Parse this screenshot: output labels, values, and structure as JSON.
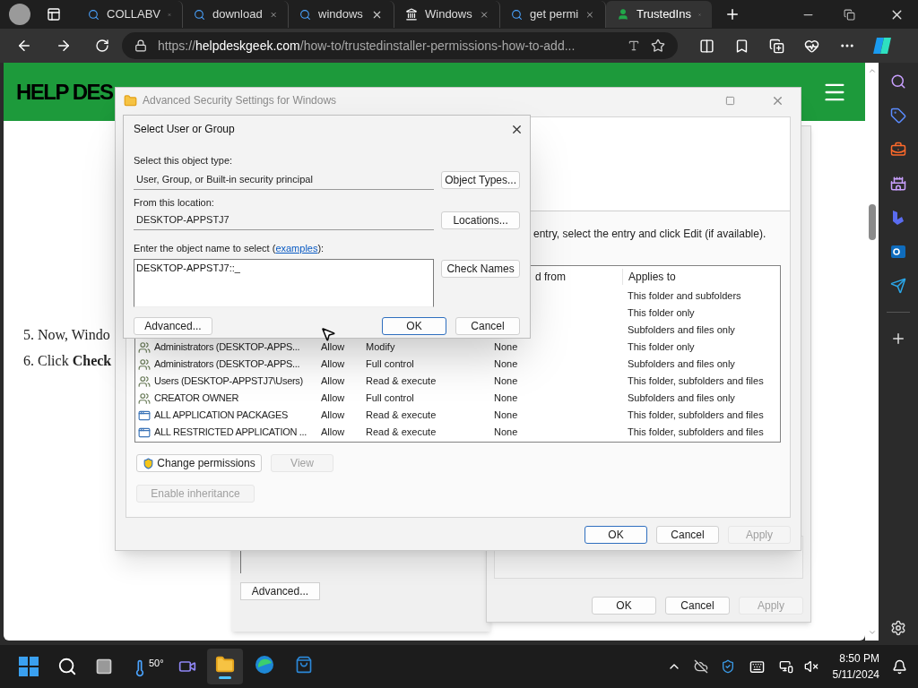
{
  "browser": {
    "tabs": [
      {
        "title": "COLLABV",
        "kind": "search",
        "selected": false
      },
      {
        "title": "download",
        "kind": "search",
        "selected": false
      },
      {
        "title": "windows",
        "kind": "search",
        "selected": false
      },
      {
        "title": "Windows",
        "kind": "site",
        "selected": false
      },
      {
        "title": "get permi",
        "kind": "search",
        "selected": false
      },
      {
        "title": "TrustedIns",
        "kind": "person",
        "selected": true
      }
    ],
    "url": {
      "scheme": "https://",
      "host": "helpdeskgeek.com",
      "path": "/how-to/trustedinstaller-permissions-how-to-add..."
    }
  },
  "page": {
    "logo": "HELP DES",
    "steps": [
      "5. Now, Windo",
      "6. Click **Check**"
    ]
  },
  "back_windows": {
    "advanced_button": "Advanced...",
    "buttons": [
      {
        "label": "OK",
        "disabled": false
      },
      {
        "label": "Cancel",
        "disabled": false
      },
      {
        "label": "Apply",
        "disabled": true
      }
    ]
  },
  "advanced_security": {
    "title": "Advanced Security Settings for Windows",
    "instruction": "entry, select the entry and click Edit (if available).",
    "columns": [
      "d from",
      "Applies to"
    ],
    "entries": [
      {
        "applies_to": "This folder and subfolders"
      },
      {
        "applies_to": "This folder only"
      },
      {
        "applies_to": "Subfolders and files only"
      },
      {
        "kind": "users",
        "principal": "Administrators (DESKTOP-APPS...",
        "type": "Allow",
        "access": "Modify",
        "inherited": "None",
        "applies_to": "This folder only"
      },
      {
        "kind": "users",
        "principal": "Administrators (DESKTOP-APPS...",
        "type": "Allow",
        "access": "Full control",
        "inherited": "None",
        "applies_to": "Subfolders and files only"
      },
      {
        "kind": "users",
        "principal": "Users (DESKTOP-APPSTJ7\\Users)",
        "type": "Allow",
        "access": "Read & execute",
        "inherited": "None",
        "applies_to": "This folder, subfolders and files"
      },
      {
        "kind": "users",
        "principal": "CREATOR OWNER",
        "type": "Allow",
        "access": "Full control",
        "inherited": "None",
        "applies_to": "Subfolders and files only"
      },
      {
        "kind": "package",
        "principal": "ALL APPLICATION PACKAGES",
        "type": "Allow",
        "access": "Read & execute",
        "inherited": "None",
        "applies_to": "This folder, subfolders and files"
      },
      {
        "kind": "package",
        "principal": "ALL RESTRICTED APPLICATION ...",
        "type": "Allow",
        "access": "Read & execute",
        "inherited": "None",
        "applies_to": "This folder, subfolders and files"
      }
    ],
    "change_permissions": "Change permissions",
    "view": {
      "label": "View",
      "disabled": true
    },
    "enable_inheritance": {
      "label": "Enable inheritance",
      "disabled": true
    },
    "footer_buttons": [
      {
        "label": "OK",
        "disabled": false,
        "default": true
      },
      {
        "label": "Cancel",
        "disabled": false,
        "default": false
      },
      {
        "label": "Apply",
        "disabled": true,
        "default": false
      }
    ]
  },
  "select_dialog": {
    "title": "Select User or Group",
    "object_type_label": "Select this object type:",
    "object_type": "User, Group, or Built-in security principal",
    "object_types_button": "Object Types...",
    "location_label": "From this location:",
    "location": "DESKTOP-APPSTJ7",
    "locations_button": "Locations...",
    "name_label_before": "Enter the object name to select (",
    "name_label_link": "examples",
    "name_label_after": "):",
    "name_value": "DESKTOP-APPSTJ7::_",
    "check_names_button": "Check Names",
    "advanced_button": "Advanced...",
    "ok_button": "OK",
    "cancel_button": "Cancel"
  },
  "taskbar": {
    "weather": "50°",
    "apps": [
      {
        "kind": "explorer",
        "active": true
      },
      {
        "kind": "edge",
        "active": false
      },
      {
        "kind": "store",
        "active": false
      }
    ],
    "time": "8:50 PM",
    "date": "5/11/2024"
  }
}
